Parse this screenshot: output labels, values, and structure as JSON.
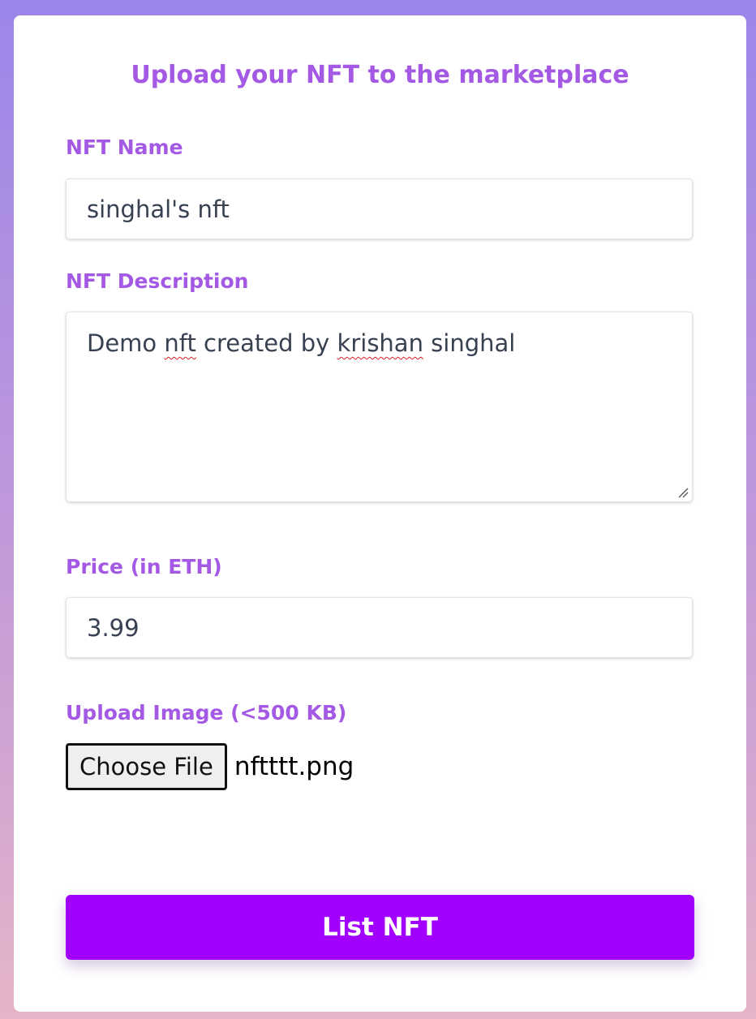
{
  "form": {
    "title": "Upload your NFT to the marketplace",
    "name": {
      "label": "NFT Name",
      "value": "singhal's nft"
    },
    "description": {
      "label": "NFT Description",
      "value_parts": [
        "Demo ",
        "nft",
        " created by ",
        "krishan",
        " singhal"
      ]
    },
    "price": {
      "label": "Price (in ETH)",
      "value": "3.99"
    },
    "image": {
      "label": "Upload Image (<500 KB)",
      "button_label": "Choose File",
      "file_name": "nftttt.png"
    },
    "submit_label": "List NFT"
  },
  "colors": {
    "accent": "#a459e4",
    "button": "#a100ff",
    "spellcheck": "#e02020"
  },
  "icons": {
    "textarea_resize": "resize-grip-icon"
  }
}
